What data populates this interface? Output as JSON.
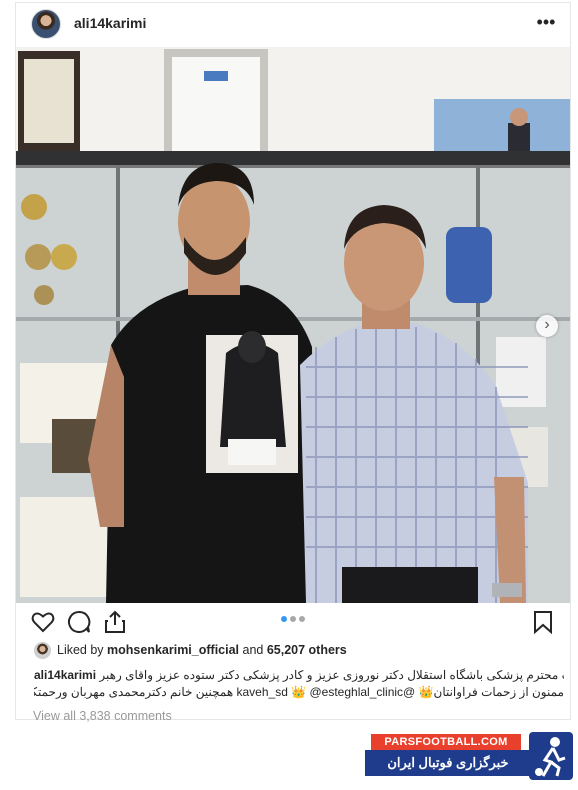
{
  "post": {
    "username": "ali14karimi",
    "more_icon": "more-options-icon",
    "likes": {
      "prefix": "Liked by ",
      "user": "mohsenkarimi_official",
      "middle": " and ",
      "count": "65,207 others"
    },
    "caption": {
      "line1": "معاونت محترم پزشکی  باشگاه استقلال دکتر نوروزی عزیز و کادر پزشکی دکتر ستوده عزیز واقای رهبر❤️",
      "user": "ali14karimi",
      "line2": "ممنون از زحمات فراوانتان👑 @kaveh_sd 👑 @esteghlal_clinic همچنین خانم دکترمحمدی مهربان ورحمتکش"
    },
    "view_all": "View all 3,838 comments",
    "carousel": {
      "total": 3,
      "active": 0
    }
  },
  "icons": {
    "like": "heart-icon",
    "comment": "comment-icon",
    "share": "share-icon",
    "save": "bookmark-icon",
    "next": "chevron-right-icon"
  },
  "watermark": {
    "top": "PARSFOOTBALL.COM",
    "bottom": "خبرگزاری فوتبال ایران"
  },
  "colors": {
    "accent": "#3897f0",
    "watermark_red": "#e8402c",
    "watermark_blue": "#1e3b8c"
  }
}
